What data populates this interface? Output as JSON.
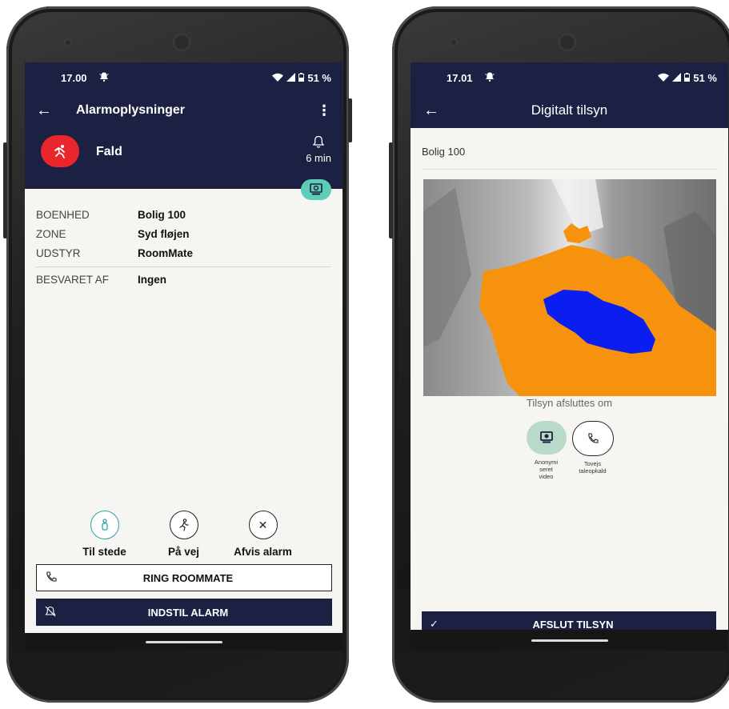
{
  "left": {
    "status": {
      "time": "17.00",
      "battery": "51 %"
    },
    "appbar": {
      "title": "Alarmoplysninger"
    },
    "alarm": {
      "type": "Fald",
      "elapsed": "6 min"
    },
    "info": [
      {
        "label": "BOENHED",
        "value": "Bolig 100"
      },
      {
        "label": "ZONE",
        "value": "Syd fløjen"
      },
      {
        "label": "UDSTYR",
        "value": "RoomMate"
      },
      {
        "label": "BESVARET AF",
        "value": "Ingen"
      }
    ],
    "actions": [
      {
        "label": "Til stede",
        "icon": "person-icon"
      },
      {
        "label": "På vej",
        "icon": "walking-icon"
      },
      {
        "label": "Afvis alarm",
        "icon": "close-icon"
      }
    ],
    "buttons": {
      "ring": "RING ROOMMATE",
      "indstil": "INDSTIL ALARM"
    }
  },
  "right": {
    "status": {
      "time": "17.01",
      "battery": "51 %"
    },
    "appbar": {
      "title": "Digitalt tilsyn"
    },
    "unit": "Bolig 100",
    "tilsyn_text": "Tilsyn afsluttes om",
    "options": [
      {
        "label": "Anonymiseret video",
        "lines": [
          "Anonymi",
          "seret",
          "video"
        ],
        "icon": "camera-icon"
      },
      {
        "label": "Tovejs taleopkald",
        "lines": [
          "Tovejs",
          "taleopkald"
        ],
        "icon": "phone-icon"
      }
    ],
    "button": "AFSLUT TILSYN"
  },
  "colors": {
    "navy": "#1c2043",
    "alarm_red": "#e8262b",
    "teal": "#5ecdb6",
    "thermal_orange": "#f7920e",
    "thermal_blue": "#0a1ef0"
  }
}
